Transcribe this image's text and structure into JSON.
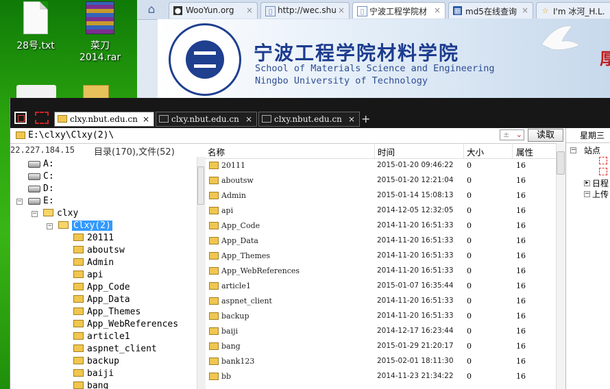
{
  "desktop": {
    "icons": [
      {
        "label": "28号.txt"
      },
      {
        "label": "菜刀2014.rar"
      }
    ]
  },
  "browser": {
    "tabs": [
      {
        "title": "WooYun.org"
      },
      {
        "title": "http://wec.shu"
      },
      {
        "title": "宁波工程学院材"
      },
      {
        "title": "md5在线查询"
      },
      {
        "title": "I'm 冰河_H.L."
      }
    ],
    "banner": {
      "title_cn": "宁波工程学院材料学院",
      "title_en1": "School of Materials Science and Engineering",
      "title_en2": "Ningbo University of Technology",
      "side_text": "厚"
    }
  },
  "tool": {
    "tabs": [
      {
        "title": "clxy.nbut.edu.cn"
      },
      {
        "title": "clxy.nbut.edu.cn"
      },
      {
        "title": "clxy.nbut.edu.cn"
      }
    ],
    "plus": "+",
    "path": "E:\\clxy\\Clxy(2)\\",
    "combo_value": "±",
    "read_button": "读取",
    "ip": "22.227.184.15",
    "counts": "目录(170),文件(52)",
    "tree": {
      "drives": [
        "A:",
        "C:",
        "D:",
        "E:"
      ],
      "clxy": "clxy",
      "selected": "Clxy(2)",
      "folders": [
        "20111",
        "aboutsw",
        "Admin",
        "api",
        "App_Code",
        "App_Data",
        "App_Themes",
        "App_WebReferences",
        "article1",
        "aspnet_client",
        "backup",
        "baiji",
        "bang"
      ]
    },
    "list": {
      "headers": {
        "name": "名称",
        "time": "时间",
        "size": "大小",
        "attr": "属性"
      },
      "rows": [
        {
          "name": "20111",
          "time": "2015-01-20 09:46:22",
          "size": "0",
          "attr": "16"
        },
        {
          "name": "aboutsw",
          "time": "2015-01-20 12:21:04",
          "size": "0",
          "attr": "16"
        },
        {
          "name": "Admin",
          "time": "2015-01-14 15:08:13",
          "size": "0",
          "attr": "16"
        },
        {
          "name": "api",
          "time": "2014-12-05 12:32:05",
          "size": "0",
          "attr": "16"
        },
        {
          "name": "App_Code",
          "time": "2014-11-20 16:51:33",
          "size": "0",
          "attr": "16"
        },
        {
          "name": "App_Data",
          "time": "2014-11-20 16:51:33",
          "size": "0",
          "attr": "16"
        },
        {
          "name": "App_Themes",
          "time": "2014-11-20 16:51:33",
          "size": "0",
          "attr": "16"
        },
        {
          "name": "App_WebReferences",
          "time": "2014-11-20 16:51:33",
          "size": "0",
          "attr": "16"
        },
        {
          "name": "article1",
          "time": "2015-01-07 16:35:44",
          "size": "0",
          "attr": "16"
        },
        {
          "name": "aspnet_client",
          "time": "2014-11-20 16:51:33",
          "size": "0",
          "attr": "16"
        },
        {
          "name": "backup",
          "time": "2014-11-20 16:51:33",
          "size": "0",
          "attr": "16"
        },
        {
          "name": "baiji",
          "time": "2014-12-17 16:23:44",
          "size": "0",
          "attr": "16"
        },
        {
          "name": "bang",
          "time": "2015-01-29 21:20:17",
          "size": "0",
          "attr": "16"
        },
        {
          "name": "bank123",
          "time": "2015-02-01 18:11:30",
          "size": "0",
          "attr": "16"
        },
        {
          "name": "bb",
          "time": "2014-11-23 21:34:22",
          "size": "0",
          "attr": "16"
        }
      ]
    },
    "right_panel": {
      "date": "星期三",
      "items": [
        "站点",
        "日程",
        "上传"
      ]
    }
  }
}
